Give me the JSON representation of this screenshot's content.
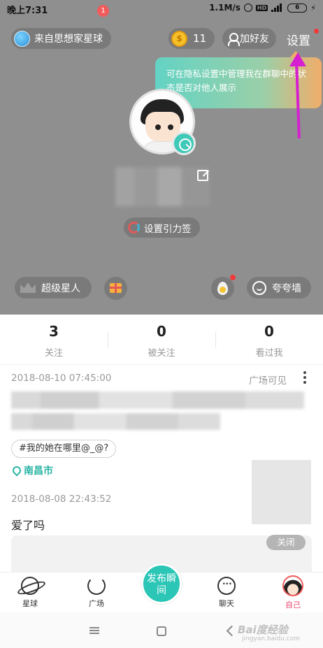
{
  "status_bar": {
    "time": "晚上7:31",
    "speed": "1.1M/s",
    "hd": "HD",
    "battery": "6"
  },
  "header": {
    "planet_chip": "来自思想家星球",
    "coins": "11",
    "add_friend": "加好友",
    "settings": "设置"
  },
  "tooltip": {
    "text": "可在隐私设置中管理我在群聊中的状态是否对他人展示"
  },
  "profile": {
    "gravity_tag": "设置引力签",
    "super_star": "超级星人",
    "praise_wall": "夸夸墙"
  },
  "stats": [
    {
      "count": "3",
      "label": "关注"
    },
    {
      "count": "0",
      "label": "被关注"
    },
    {
      "count": "0",
      "label": "看过我"
    }
  ],
  "posts": [
    {
      "datetime": "2018-08-10 07:45:00",
      "visibility": "广场可见",
      "topic": "#我的她在哪里@_@?",
      "location": "南昌市"
    },
    {
      "datetime": "2018-08-08 22:43:52",
      "text": "爱了吗",
      "close": "关闭"
    }
  ],
  "tabbar": {
    "planet": "星球",
    "plaza": "广场",
    "plaza_badge": "1",
    "publish": "发布瞬间",
    "chat": "聊天",
    "me": "自己"
  },
  "watermark": {
    "brand": "Bai度经验",
    "url": "jingyan.baidu.com"
  },
  "colors": {
    "accent": "#2bc6b6",
    "arrow": "#d61fd0",
    "badge": "#f23a3a"
  }
}
